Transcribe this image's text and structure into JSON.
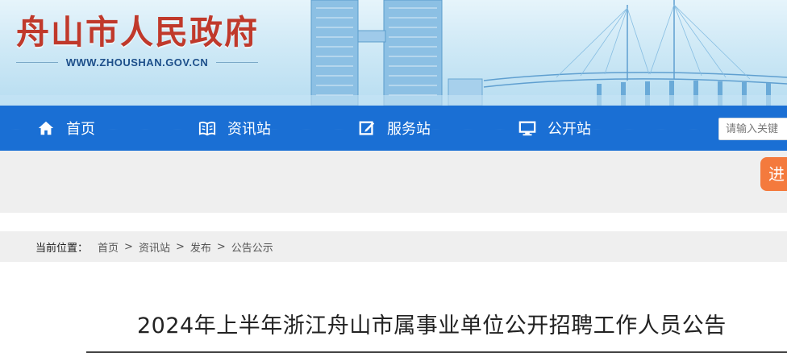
{
  "header": {
    "site_title": "舟山市人民政府",
    "site_url": "WWW.ZHOUSHAN.GOV.CN"
  },
  "nav": {
    "items": [
      {
        "label": "首页",
        "icon": "home-icon"
      },
      {
        "label": "资讯站",
        "icon": "book-icon"
      },
      {
        "label": "服务站",
        "icon": "edit-icon"
      },
      {
        "label": "公开站",
        "icon": "monitor-icon"
      }
    ],
    "search_placeholder": "请输入关键"
  },
  "side_button": {
    "label": "进"
  },
  "breadcrumb": {
    "label": "当前位置：",
    "items": [
      "首页",
      "资讯站",
      "发布",
      "公告公示"
    ],
    "separator": ">"
  },
  "article": {
    "title": "2024年上半年浙江舟山市属事业单位公开招聘工作人员公告"
  },
  "colors": {
    "nav_bg": "#1a6fd4",
    "title_red": "#c0392b",
    "accent_orange": "#f47a3d"
  }
}
